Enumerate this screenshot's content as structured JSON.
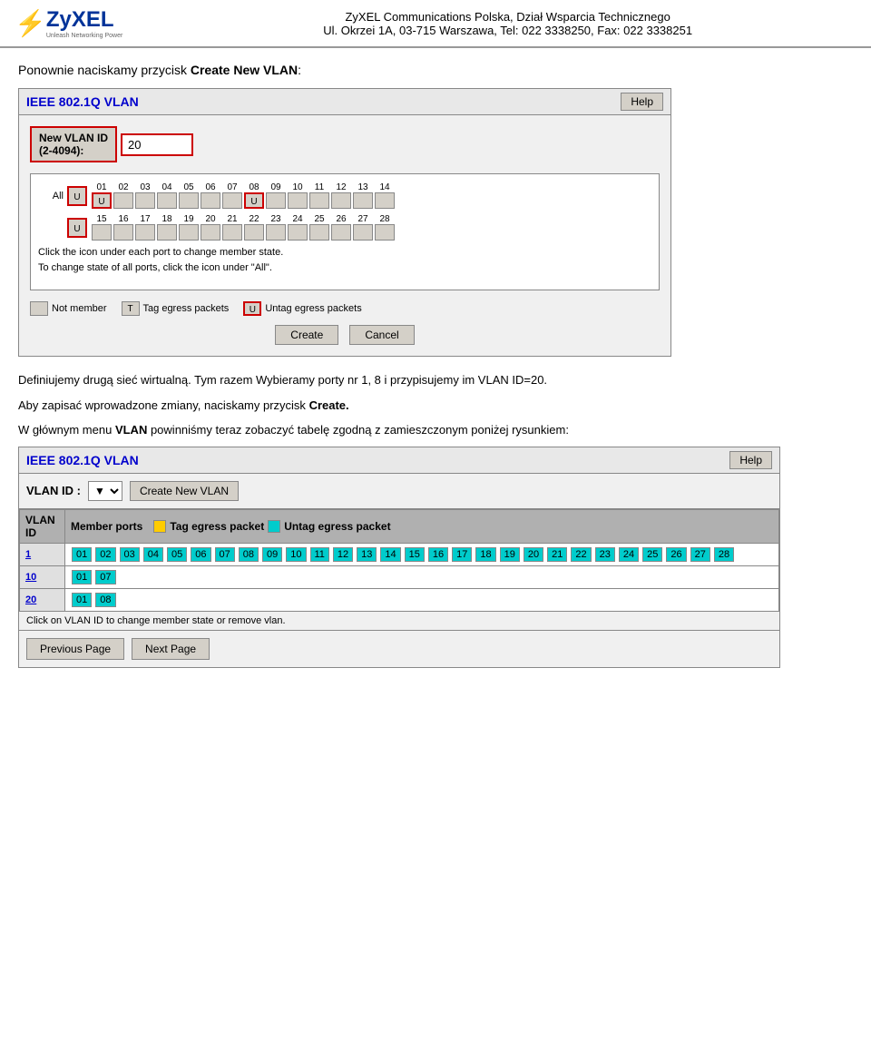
{
  "header": {
    "company": "ZyXEL Communications Polska, Dział Wsparcia Technicznego",
    "address": "Ul. Okrzei 1A, 03-715 Warszawa, Tel:  022 3338250, Fax: 022 3338251",
    "logo_text": "ZyXEL",
    "logo_tagline": "Unleash Networking Power"
  },
  "panel1": {
    "title": "IEEE 802.1Q VLAN",
    "help_label": "Help",
    "vlan_id_label": "New VLAN ID\n(2-4094):",
    "vlan_id_value": "20",
    "ports_row1": [
      "01",
      "02",
      "03",
      "04",
      "05",
      "06",
      "07",
      "08",
      "09",
      "10",
      "11",
      "12",
      "13",
      "14"
    ],
    "ports_row2": [
      "15",
      "16",
      "17",
      "18",
      "19",
      "20",
      "21",
      "22",
      "23",
      "24",
      "25",
      "26",
      "27",
      "28"
    ],
    "hint1": "Click the icon under each port to change member state.",
    "hint2": "To change state of all ports, click the icon under \"All\".",
    "legend_notmember": "Not member",
    "legend_tag": "Tag egress packets",
    "legend_untag": "Untag egress packets",
    "create_btn": "Create",
    "cancel_btn": "Cancel"
  },
  "text1": "Ponownie naciskamy przycisk",
  "bold1": "Create New VLAN",
  "text2": "Definiujemy drugą sieć wirtualną. Tym razem Wybieramy porty nr 1, 8 i przypisujemy im VLAN ID=20.",
  "text3": "Aby zapisać wprowadzone zmiany, naciskamy przycisk",
  "bold3": "Create.",
  "text4": "W głównym menu",
  "bold4": "VLAN",
  "text5": "powinniśmy teraz zobaczyć tabelę zgodną z zamieszczonym poniżej rysunkiem:",
  "panel2": {
    "title": "IEEE 802.1Q VLAN",
    "help_label": "Help",
    "vlan_id_label": "VLAN ID :",
    "create_vlan_btn": "Create New VLAN",
    "table_headers": {
      "vlan_id": "VLAN\nID",
      "member_ports": "Member ports",
      "tag_label": "Tag egress packet",
      "untag_label": "Untag egress packet"
    },
    "rows": [
      {
        "id": "1",
        "ports": [
          "01",
          "02",
          "03",
          "04",
          "05",
          "06",
          "07",
          "08",
          "09",
          "10",
          "11",
          "12",
          "13",
          "14",
          "15",
          "16",
          "17",
          "18",
          "19",
          "20",
          "21",
          "22",
          "23",
          "24",
          "25",
          "26",
          "27",
          "28"
        ],
        "ports_row2": [
          "27",
          "28"
        ],
        "type": "untag"
      },
      {
        "id": "10",
        "ports": [
          "01",
          "07"
        ],
        "type": "untag"
      },
      {
        "id": "20",
        "ports": [
          "01",
          "08"
        ],
        "type": "untag"
      }
    ],
    "note": "Click on VLAN ID to change member state or remove vlan.",
    "prev_btn": "Previous Page",
    "next_btn": "Next Page"
  }
}
